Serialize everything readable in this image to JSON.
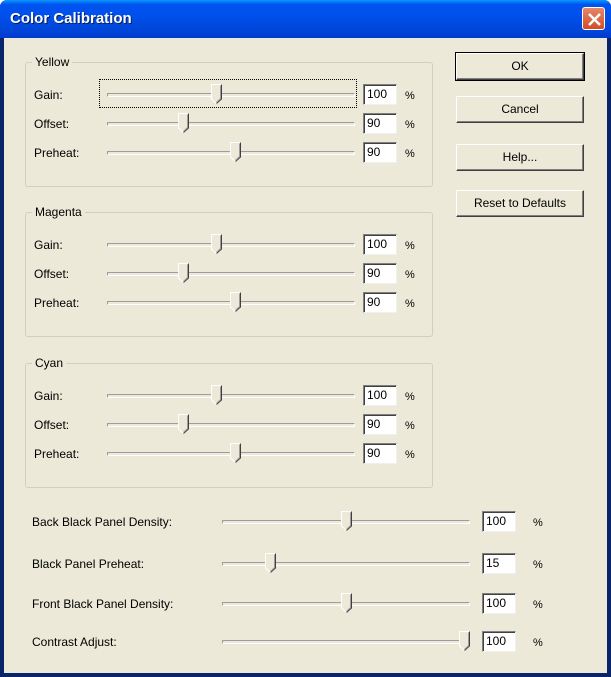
{
  "window": {
    "title": "Color Calibration"
  },
  "buttons": {
    "ok": "OK",
    "cancel": "Cancel",
    "help": "Help...",
    "reset": "Reset to Defaults"
  },
  "groups": [
    {
      "label": "Yellow",
      "rows": [
        {
          "label": "Gain:",
          "value": "100",
          "unit": "%",
          "level": 0.44
        },
        {
          "label": "Offset:",
          "value": "90",
          "unit": "%",
          "level": 0.3
        },
        {
          "label": "Preheat:",
          "value": "90",
          "unit": "%",
          "level": 0.52
        }
      ]
    },
    {
      "label": "Magenta",
      "rows": [
        {
          "label": "Gain:",
          "value": "100",
          "unit": "%",
          "level": 0.44
        },
        {
          "label": "Offset:",
          "value": "90",
          "unit": "%",
          "level": 0.3
        },
        {
          "label": "Preheat:",
          "value": "90",
          "unit": "%",
          "level": 0.52
        }
      ]
    },
    {
      "label": "Cyan",
      "rows": [
        {
          "label": "Gain:",
          "value": "100",
          "unit": "%",
          "level": 0.44
        },
        {
          "label": "Offset:",
          "value": "90",
          "unit": "%",
          "level": 0.3
        },
        {
          "label": "Preheat:",
          "value": "90",
          "unit": "%",
          "level": 0.52
        }
      ]
    }
  ],
  "bottom": [
    {
      "label": "Back Black Panel Density:",
      "value": "100",
      "unit": "%",
      "level": 0.5
    },
    {
      "label": "Black Panel Preheat:",
      "value": "15",
      "unit": "%",
      "level": 0.18
    },
    {
      "label": "Front Black Panel Density:",
      "value": "100",
      "unit": "%",
      "level": 0.5
    },
    {
      "label": "Contrast Adjust:",
      "value": "100",
      "unit": "%",
      "level": 1.0
    }
  ]
}
